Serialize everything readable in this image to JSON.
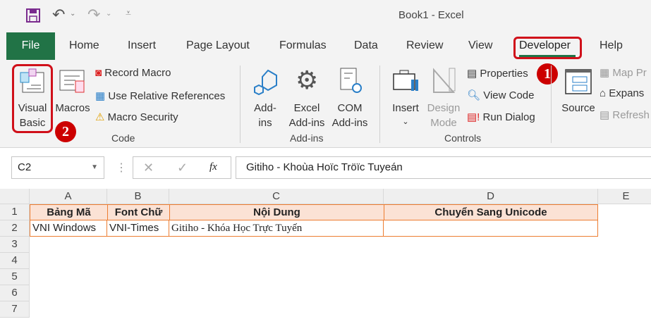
{
  "title": "Book1  -  Excel",
  "tabs": [
    "File",
    "Home",
    "Insert",
    "Page Layout",
    "Formulas",
    "Data",
    "Review",
    "View",
    "Developer",
    "Help"
  ],
  "ribbon": {
    "code": {
      "visual_basic": [
        "Visual",
        "Basic"
      ],
      "macros": "Macros",
      "record_macro": "Record Macro",
      "use_relative": "Use Relative References",
      "macro_security": "Macro Security",
      "group": "Code"
    },
    "addins": {
      "addins": [
        "Add-",
        "ins"
      ],
      "excel_addins": [
        "Excel",
        "Add-ins"
      ],
      "com_addins": [
        "COM",
        "Add-ins"
      ],
      "group": "Add-ins"
    },
    "controls": {
      "insert": "Insert",
      "design_mode": [
        "Design",
        "Mode"
      ],
      "properties": "Properties",
      "view_code": "View Code",
      "run_dialog": "Run Dialog",
      "group": "Controls"
    },
    "xml": {
      "source": "Source",
      "map_properties": "Map Pr",
      "expansion_packs": "Expans",
      "refresh_data": "Refresh"
    }
  },
  "badges": [
    "1",
    "2"
  ],
  "formula_bar": {
    "name_box": "C2",
    "fx": "fx",
    "content": "Gitiho - Khoùa Hoïc Tröïc Tuyeán"
  },
  "columns": [
    "A",
    "B",
    "C",
    "D",
    "E"
  ],
  "rows": [
    "1",
    "2",
    "3",
    "4",
    "5",
    "6",
    "7"
  ],
  "table": {
    "headers": [
      "Bảng Mã",
      "Font Chữ",
      "Nội Dung",
      "Chuyển Sang Unicode"
    ],
    "row": [
      "VNI Windows",
      "VNI-Times",
      "Gitiho - Khóa Học Trực Tuyến",
      ""
    ]
  }
}
